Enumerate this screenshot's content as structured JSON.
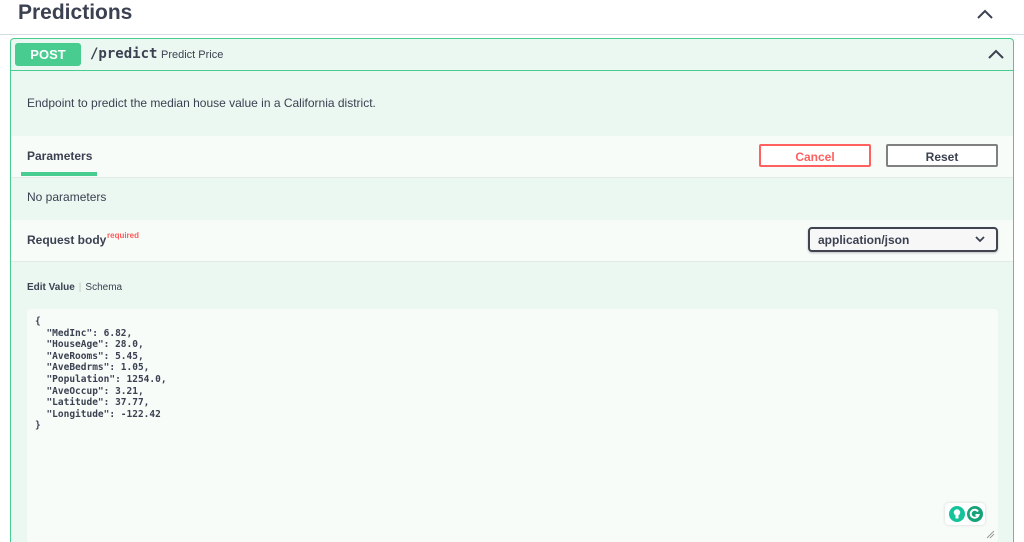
{
  "section": {
    "title": "Predictions"
  },
  "endpoint": {
    "method": "POST",
    "path": "/predict",
    "summary": "Predict Price",
    "description": "Endpoint to predict the median house value in a California district."
  },
  "parameters": {
    "tab_label": "Parameters",
    "cancel_label": "Cancel",
    "reset_label": "Reset",
    "empty_text": "No parameters"
  },
  "request_body": {
    "label": "Request body",
    "required_label": "required",
    "content_type": "application/json",
    "tabs": {
      "edit_value": "Edit Value",
      "schema": "Schema"
    },
    "value_text": "{\n  \"MedInc\": 6.82,\n  \"HouseAge\": 28.0,\n  \"AveRooms\": 5.45,\n  \"AveBedrms\": 1.05,\n  \"Population\": 1254.0,\n  \"AveOccup\": 3.21,\n  \"Latitude\": 37.77,\n  \"Longitude\": -122.42\n}"
  },
  "colors": {
    "post_green": "#49cc90",
    "block_background": "#ebf7f1",
    "cancel_red": "#ff6060",
    "text": "#3b4151"
  },
  "icons": {
    "section_toggle": "chevron-up-icon",
    "endpoint_toggle": "chevron-up-icon",
    "select_arrow": "chevron-down-icon",
    "extensions": [
      "lightbulb-icon",
      "grammarly-icon"
    ]
  }
}
